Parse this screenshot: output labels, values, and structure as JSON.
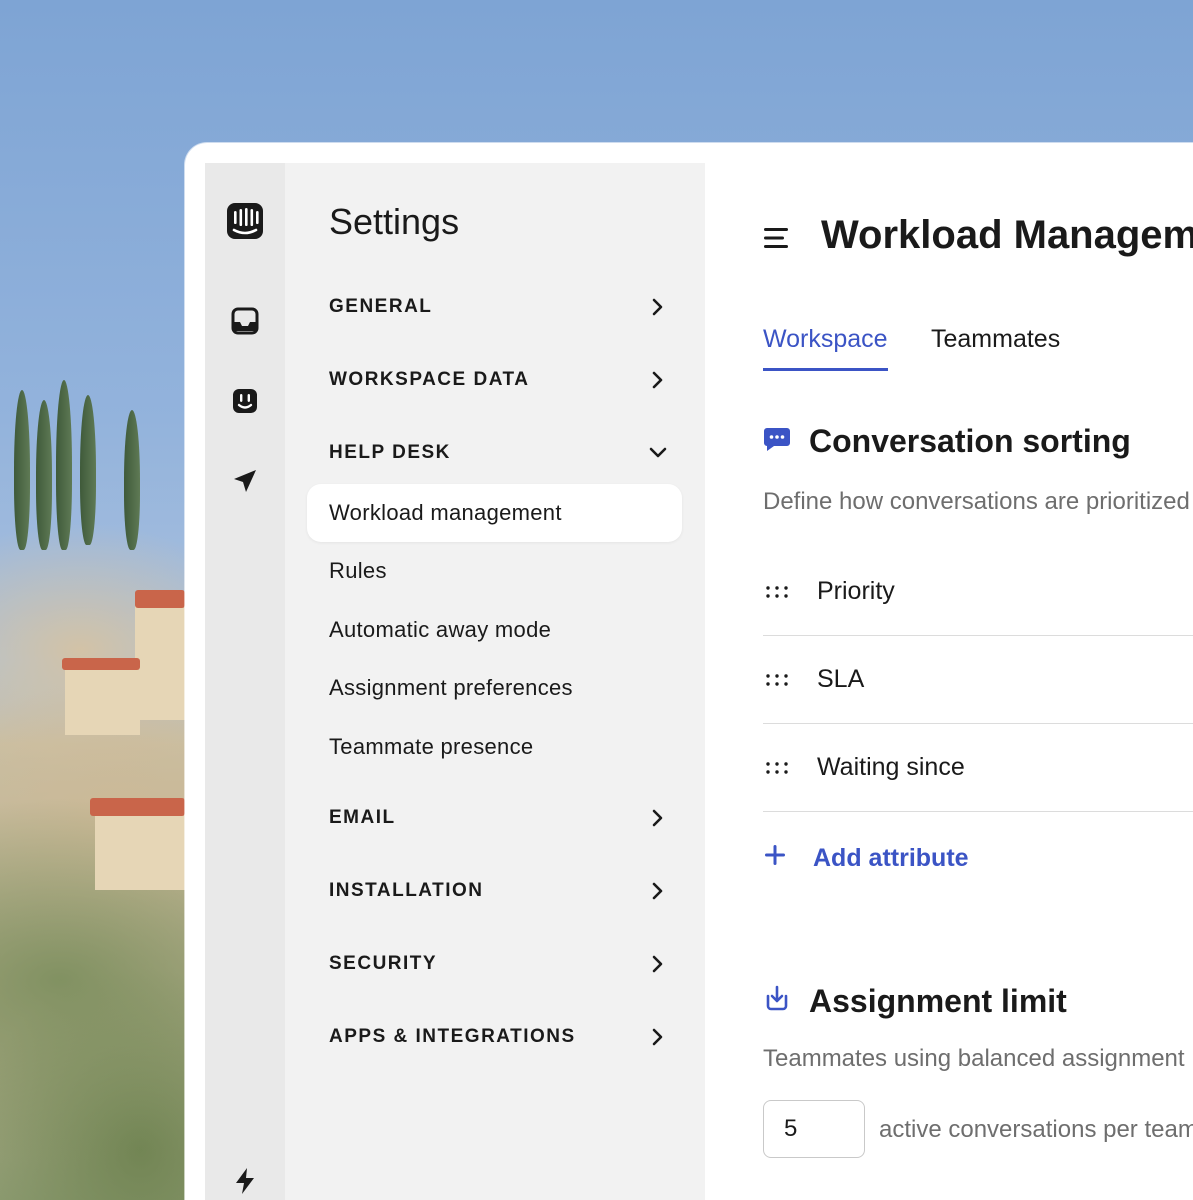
{
  "nav": {
    "title": "Settings",
    "sections": [
      {
        "label": "GENERAL"
      },
      {
        "label": "WORKSPACE DATA"
      },
      {
        "label": "HELP DESK"
      },
      {
        "label": "EMAIL"
      },
      {
        "label": "INSTALLATION"
      },
      {
        "label": "SECURITY"
      },
      {
        "label": "APPS & INTEGRATIONS"
      }
    ],
    "help_desk_items": [
      {
        "label": "Workload management"
      },
      {
        "label": "Rules"
      },
      {
        "label": "Automatic away mode"
      },
      {
        "label": "Assignment preferences"
      },
      {
        "label": "Teammate presence"
      }
    ]
  },
  "main": {
    "title": "Workload Management",
    "tabs": [
      {
        "label": "Workspace"
      },
      {
        "label": "Teammates"
      }
    ],
    "sorting": {
      "title": "Conversation sorting",
      "description": "Define how conversations are prioritized",
      "attributes": [
        {
          "label": "Priority"
        },
        {
          "label": "SLA"
        },
        {
          "label": "Waiting since"
        }
      ],
      "add_label": "Add attribute"
    },
    "limit": {
      "title": "Assignment limit",
      "description": "Teammates using balanced assignment",
      "value": "5",
      "suffix": "active conversations per teammate"
    }
  },
  "colors": {
    "accent": "#3b54c5",
    "text": "#1a1a1a",
    "muted": "#6e6e6e"
  }
}
